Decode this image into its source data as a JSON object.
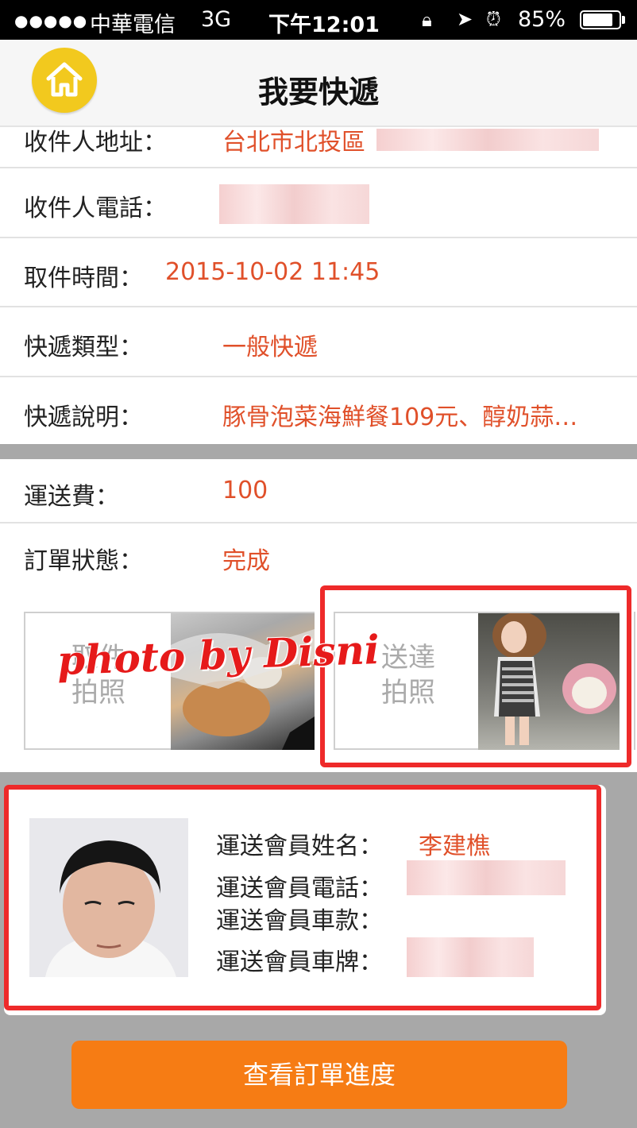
{
  "status_bar": {
    "signal": "●●●●●",
    "carrier": "中華電信",
    "network": "3G",
    "time": "下午12:01",
    "battery": "85%",
    "battery_level": 0.85
  },
  "header": {
    "title": "我要快遞",
    "home_icon": "home-icon"
  },
  "details": [
    {
      "label": "收件人地址：",
      "value": "台北市北投區"
    },
    {
      "label": "收件人電話：",
      "value": ""
    },
    {
      "label": "取件時間：",
      "value": "2015-10-02 11:45"
    },
    {
      "label": "快遞類型：",
      "value": "一般快遞"
    },
    {
      "label": "快遞說明：",
      "value": "豚骨泡菜海鮮餐109元、醇奶蒜…"
    }
  ],
  "order": [
    {
      "label": "運送費：",
      "value": "100"
    },
    {
      "label": "訂單狀態：",
      "value": "完成"
    }
  ],
  "photos": [
    {
      "label_line1": "取件",
      "label_line2": "拍照"
    },
    {
      "label_line1": "送達",
      "label_line2": "拍照"
    }
  ],
  "watermark": "photo by Disni",
  "member": {
    "name_label": "運送會員姓名：",
    "name_value": "李建樵",
    "phone_label": "運送會員電話：",
    "car_model_label": "運送會員車款：",
    "plate_label": "運送會員車牌："
  },
  "actions": {
    "progress_button": "查看訂單進度"
  },
  "colors": {
    "accent": "#f67c14",
    "value_text": "#e0502a",
    "home_button": "#f2c91e",
    "highlight": "#ee2a2a"
  }
}
